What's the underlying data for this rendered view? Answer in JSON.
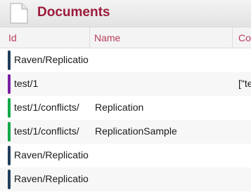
{
  "header": {
    "title": "Documents",
    "icon": "document-icon"
  },
  "columns": {
    "id": "Id",
    "name": "Name",
    "content": "Co"
  },
  "colors": {
    "title": "#9b1b3a",
    "column_header": "#b83c5c",
    "navy": "#213f5e",
    "purple": "#7b1fa2",
    "green": "#13a748"
  },
  "rows": [
    {
      "id": "Raven/Replicatio",
      "name": "",
      "content": "",
      "color": "#213f5e"
    },
    {
      "id": "test/1",
      "name": "",
      "content": "[\"te",
      "color": "#7b1fa2"
    },
    {
      "id": "test/1/conflicts/",
      "name": "Replication",
      "content": "",
      "color": "#13a748"
    },
    {
      "id": "test/1/conflicts/",
      "name": "ReplicationSample",
      "content": "",
      "color": "#13a748"
    },
    {
      "id": "Raven/Replicatio",
      "name": "",
      "content": "",
      "color": "#213f5e"
    },
    {
      "id": "Raven/Replicatio",
      "name": "",
      "content": "",
      "color": "#213f5e"
    }
  ]
}
